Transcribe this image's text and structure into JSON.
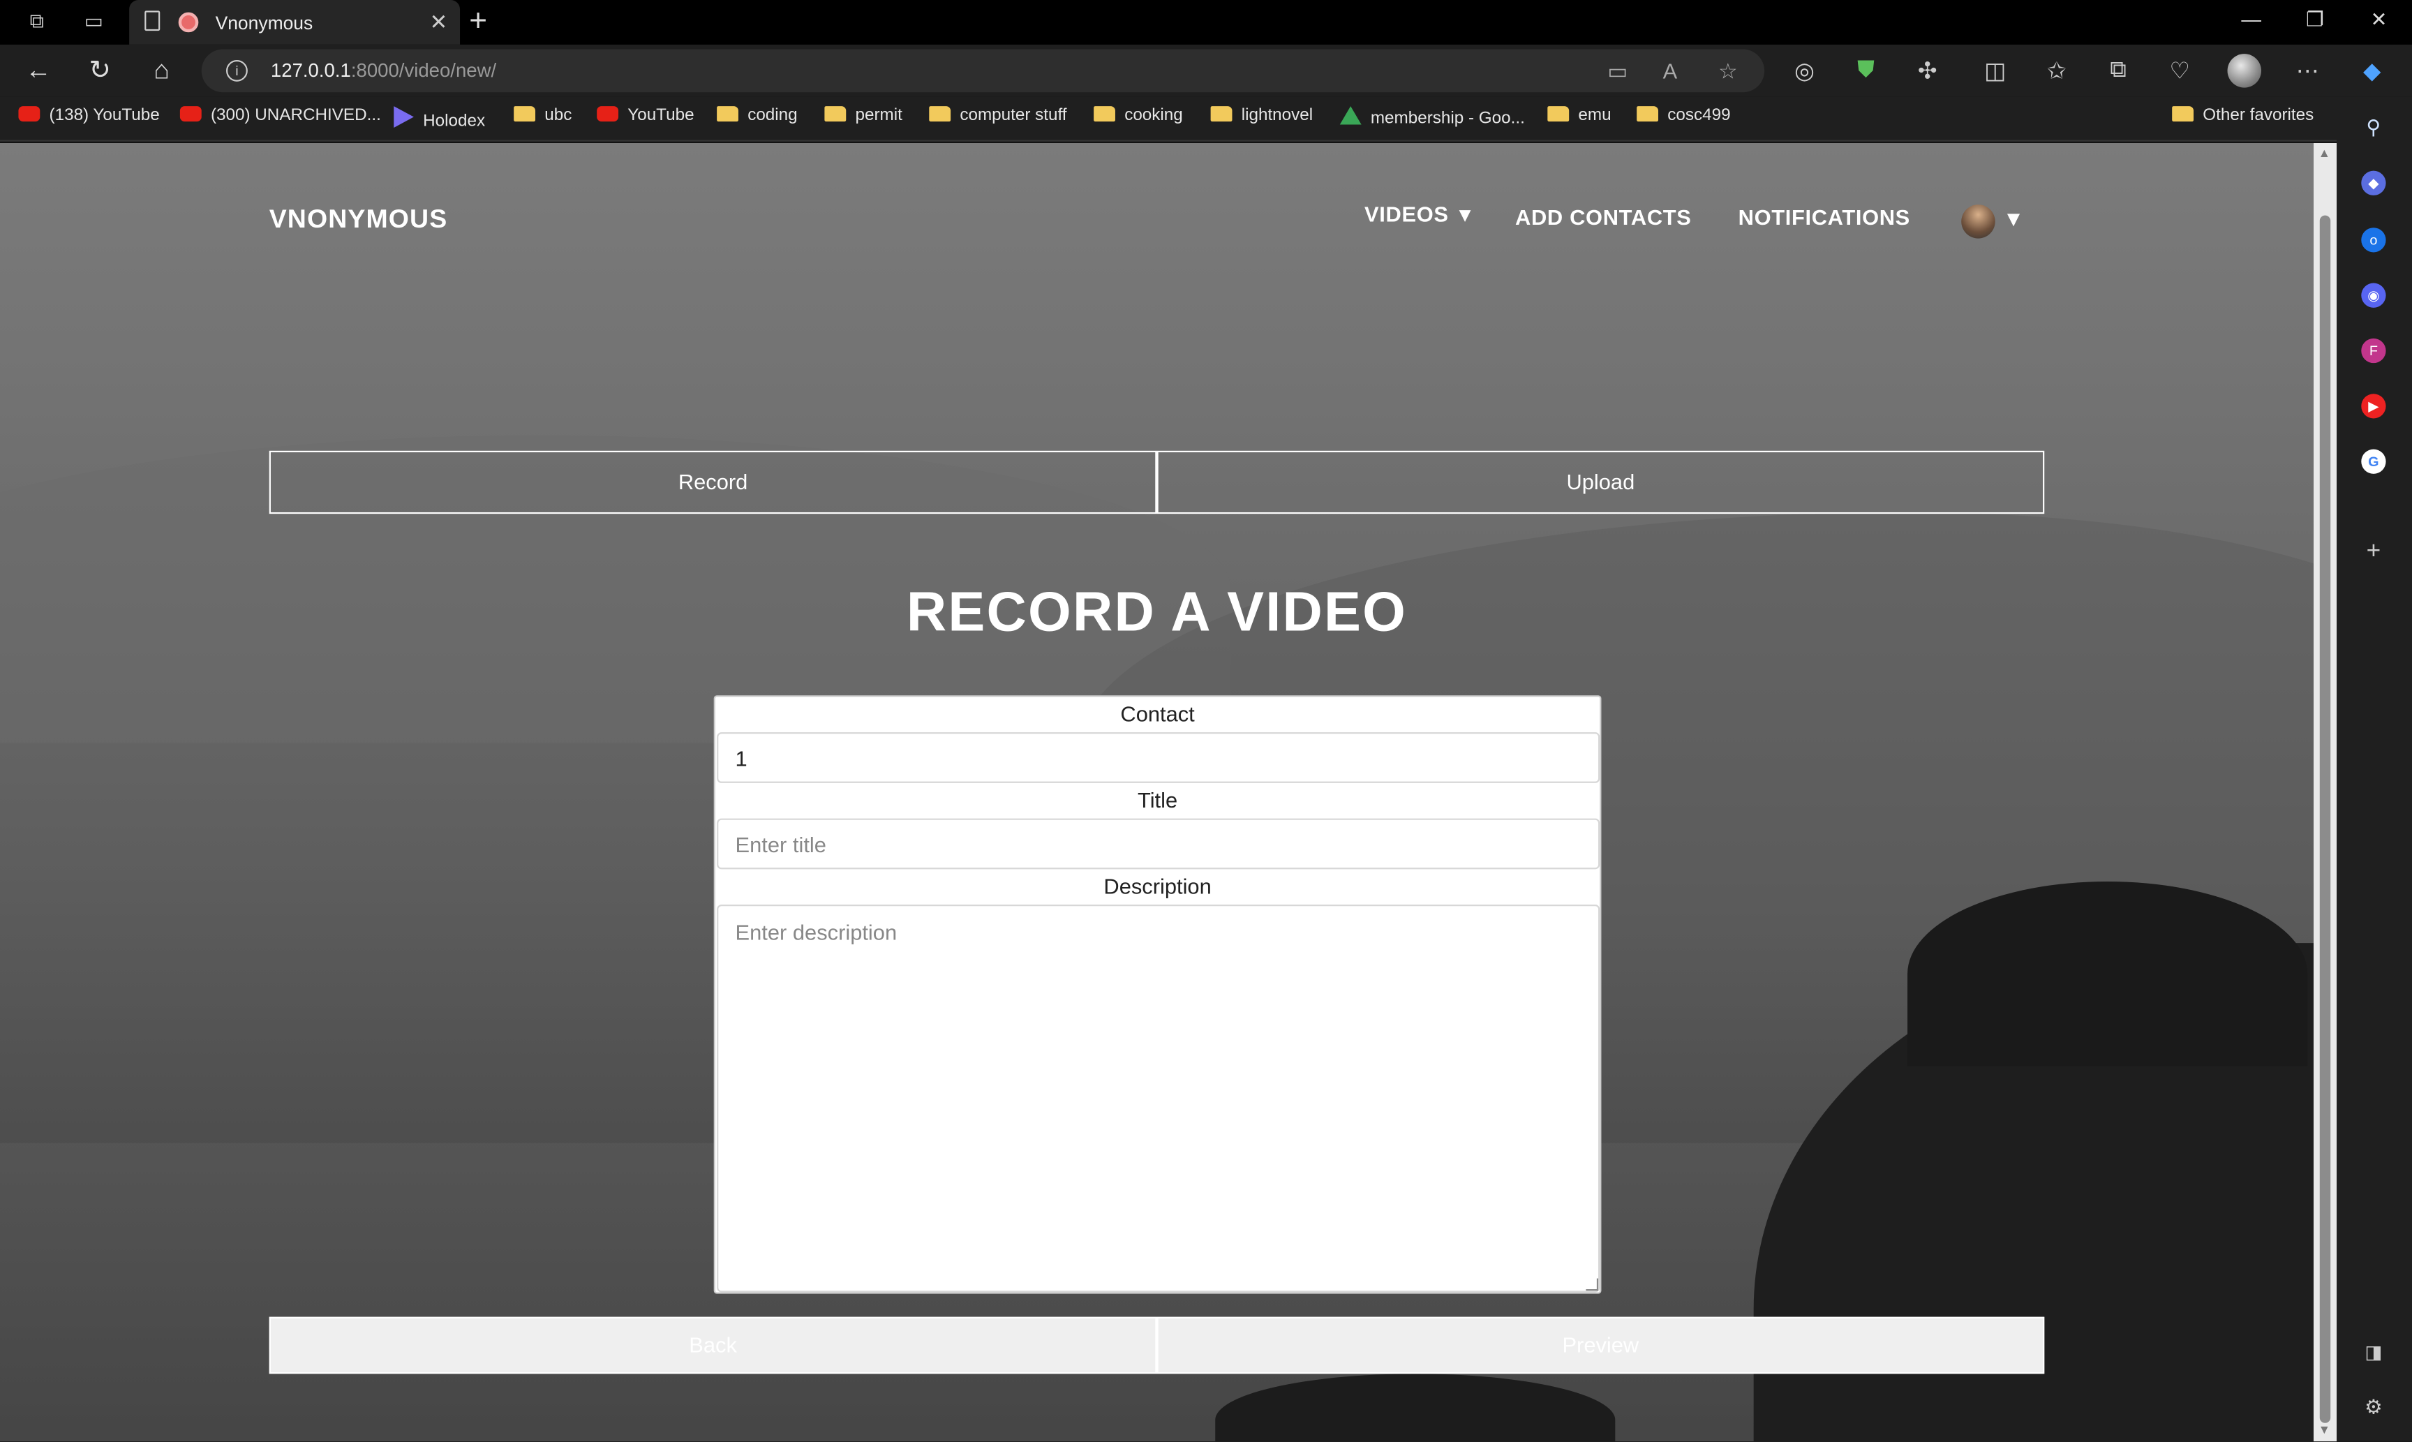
{
  "browser": {
    "tab_title": "Vnonymous",
    "url_host": "127.0.0.1",
    "url_path": ":8000/video/new/",
    "new_tab_symbol": "+",
    "bookmarks": [
      {
        "label": "(138) YouTube",
        "icon": "youtube-icon"
      },
      {
        "label": "(300) UNARCHIVED...",
        "icon": "youtube-icon"
      },
      {
        "label": "Holodex",
        "icon": "holodex-icon"
      },
      {
        "label": "ubc",
        "icon": "folder-icon"
      },
      {
        "label": "YouTube",
        "icon": "youtube-icon"
      },
      {
        "label": "coding",
        "icon": "folder-icon"
      },
      {
        "label": "permit",
        "icon": "folder-icon"
      },
      {
        "label": "computer stuff",
        "icon": "folder-icon"
      },
      {
        "label": "cooking",
        "icon": "folder-icon"
      },
      {
        "label": "lightnovel",
        "icon": "folder-icon"
      },
      {
        "label": "membership - Goo...",
        "icon": "drive-icon"
      },
      {
        "label": "emu",
        "icon": "folder-icon"
      },
      {
        "label": "cosc499",
        "icon": "folder-icon"
      }
    ],
    "other_favorites": "Other favorites"
  },
  "site": {
    "brand": "VNONYMOUS",
    "nav": {
      "videos": "VIDEOS",
      "add_contacts": "ADD CONTACTS",
      "notifications": "NOTIFICATIONS",
      "caret": "▼"
    }
  },
  "mode_toggle": {
    "record": "Record",
    "upload": "Upload"
  },
  "heading": "RECORD A VIDEO",
  "form": {
    "contact_label": "Contact",
    "contact_value": "1",
    "title_label": "Title",
    "title_placeholder": "Enter title",
    "description_label": "Description",
    "description_placeholder": "Enter description"
  },
  "actions": {
    "back": "Back",
    "preview": "Preview"
  },
  "colors": {
    "page_text": "#ffffff",
    "browser_chrome": "#1f1f1f",
    "youtube_red": "#e62117",
    "folder_yellow": "#f2ca5c"
  }
}
